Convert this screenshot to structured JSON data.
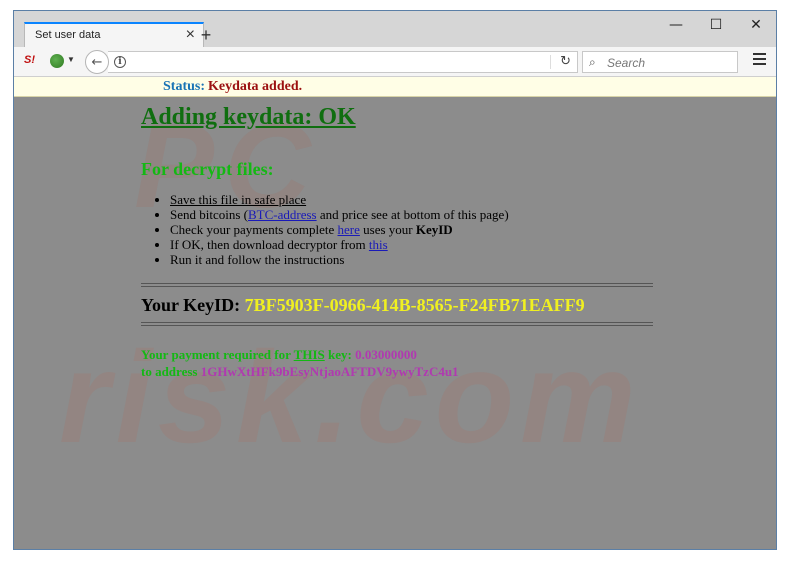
{
  "browser": {
    "tab_title": "Set user data",
    "tab_close": "×",
    "new_tab": "+",
    "window_controls": {
      "minimize": "—",
      "maximize": "☐",
      "close": "✕"
    },
    "toolbar": {
      "s_icon": "S!",
      "url_value": "",
      "search_placeholder": "Search"
    }
  },
  "status": {
    "label": "Status:",
    "value": "Keydata added."
  },
  "watermark": {
    "top": "PC",
    "bottom": "risk.com"
  },
  "page": {
    "heading": "Adding keydata: OK",
    "subheading": "For decrypt files:",
    "steps": {
      "s1": "Save this file in safe place",
      "s2_pre": "Send bitcoins (",
      "s2_link": "BTC-address",
      "s2_post": " and price see at bottom of this page)",
      "s3_pre": "Check your payments complete ",
      "s3_link": "here",
      "s3_mid": " uses your ",
      "s3_bold": "KeyID",
      "s4_pre": "If OK, then download decryptor from ",
      "s4_link": "this",
      "s5": "Run it and follow the instructions"
    },
    "keyid_label": "Your KeyID: ",
    "keyid_value": "7BF5903F-0966-414B-8565-F24FB71EAFF9",
    "payment": {
      "pre": "Your payment required for ",
      "this": "THIS",
      "post": " key: ",
      "amount": "0.03000000",
      "address_label": "to address ",
      "address": "1GHwXtHFk9bEsyNtjaoAFTDV9ywyTzC4u1"
    }
  },
  "colors": {
    "heading": "#0f6e0f",
    "green": "#14b814",
    "keyid": "#f0f020",
    "magenta": "#b03ab0",
    "status_label": "#1a73b5",
    "status_value": "#9b1010",
    "page_bg": "#8c8c8c"
  }
}
